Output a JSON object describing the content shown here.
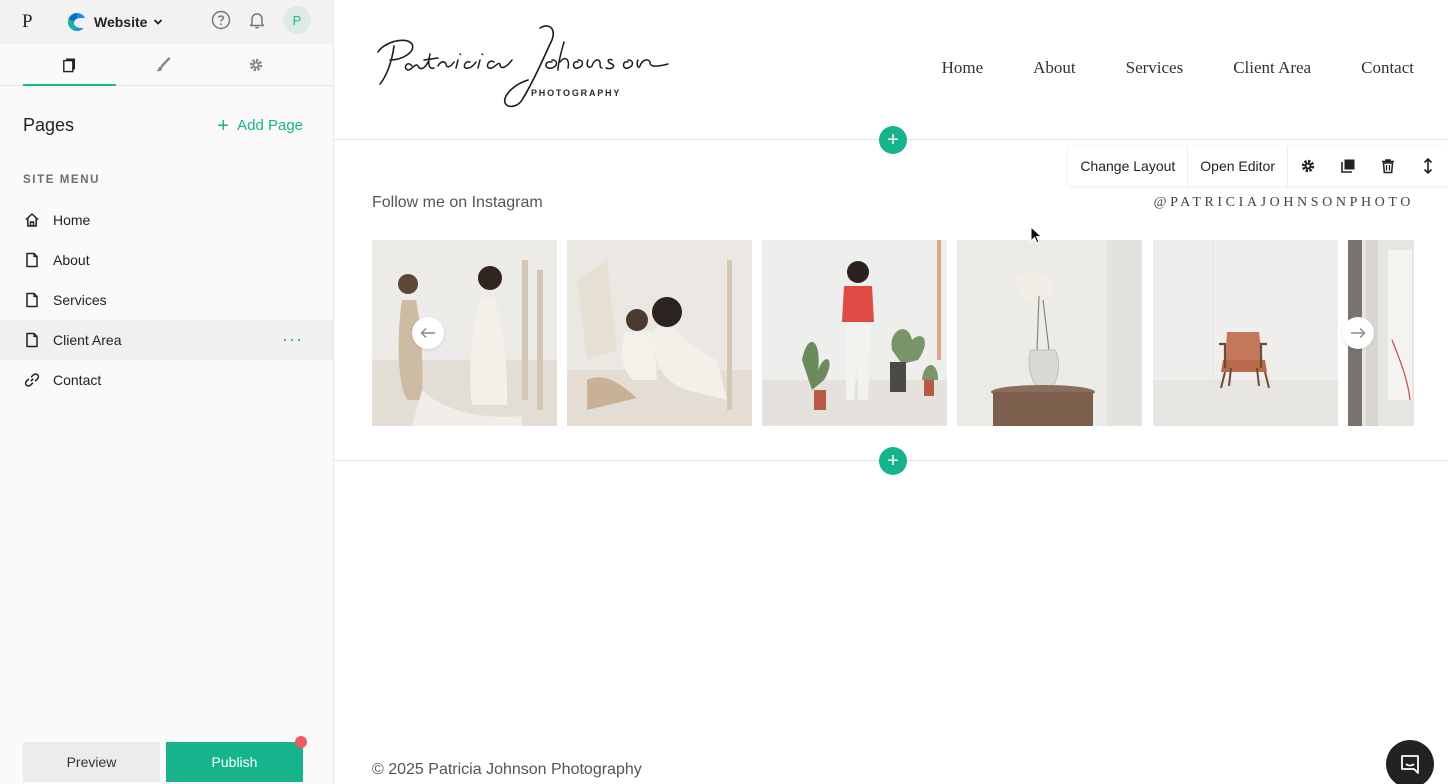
{
  "sidebar": {
    "brand": "P",
    "site_switcher": "Website",
    "avatar": "P",
    "pages_title": "Pages",
    "add_page": "Add Page",
    "site_menu_label": "SITE MENU",
    "items": [
      {
        "label": "Home",
        "icon": "home-icon"
      },
      {
        "label": "About",
        "icon": "page-icon"
      },
      {
        "label": "Services",
        "icon": "page-icon"
      },
      {
        "label": "Client Area",
        "icon": "page-icon",
        "selected": true
      },
      {
        "label": "Contact",
        "icon": "link-icon"
      }
    ],
    "more": "···",
    "preview": "Preview",
    "publish": "Publish"
  },
  "site": {
    "logo_script": "Patricia Johnson",
    "logo_sub": "PHOTOGRAPHY",
    "nav": [
      "Home",
      "About",
      "Services",
      "Client Area",
      "Contact"
    ],
    "toolbar": {
      "change_layout": "Change Layout",
      "open_editor": "Open Editor"
    },
    "instagram_label": "Follow me on Instagram",
    "instagram_handle": "@PATRICIAJOHNSONPHOTO",
    "footer": "© 2025 Patricia Johnson Photography"
  },
  "colors": {
    "accent": "#17b38d",
    "notification": "#ef5a5a"
  }
}
